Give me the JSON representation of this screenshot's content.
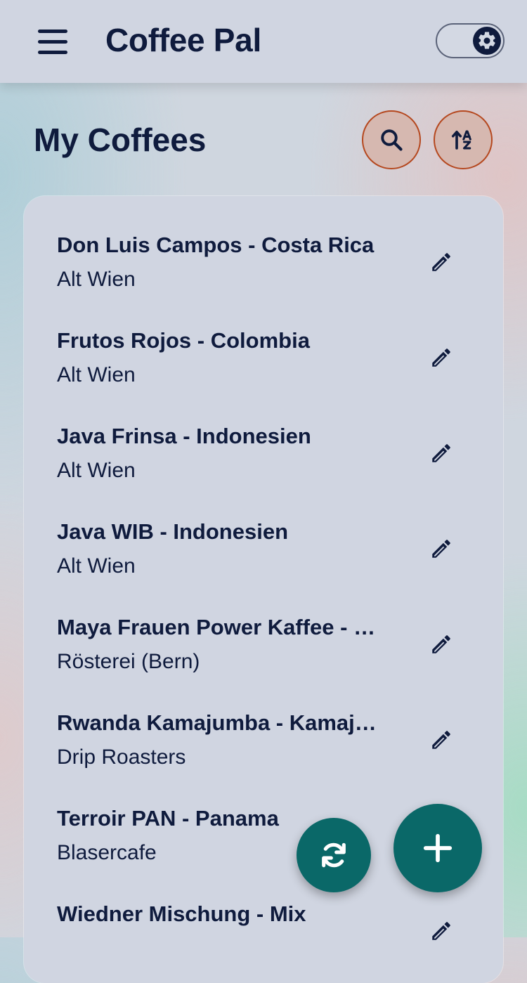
{
  "app": {
    "title": "Coffee Pal",
    "icons": {
      "menu": "hamburger-icon",
      "theme": "gear-icon"
    }
  },
  "header": {
    "title": "My Coffees",
    "actions": [
      {
        "name": "search",
        "icon": "search-icon"
      },
      {
        "name": "sort",
        "icon": "sort-alpha-icon"
      }
    ]
  },
  "coffees": [
    {
      "name": "Don Luis Campos - Costa Rica",
      "roaster": "Alt Wien"
    },
    {
      "name": "Frutos Rojos - Colombia",
      "roaster": "Alt Wien"
    },
    {
      "name": "Java Frinsa - Indonesien",
      "roaster": "Alt Wien"
    },
    {
      "name": "Java WIB - Indonesien",
      "roaster": "Alt Wien"
    },
    {
      "name": "Maya Frauen Power Kaffee - …",
      "roaster": "Rösterei (Bern)"
    },
    {
      "name": "Rwanda Kamajumba - Kamaj…",
      "roaster": "Drip Roasters"
    },
    {
      "name": "Terroir PAN - Panama",
      "roaster": "Blasercafe"
    },
    {
      "name": "Wiedner Mischung - Mix",
      "roaster": ""
    }
  ],
  "fabs": {
    "sync_icon": "sync-icon",
    "add_icon": "plus-icon"
  },
  "colors": {
    "accent": "#0a6868",
    "text": "#0f1b3d",
    "action_border": "#b5481f",
    "action_fill": "#d6b8b0"
  }
}
